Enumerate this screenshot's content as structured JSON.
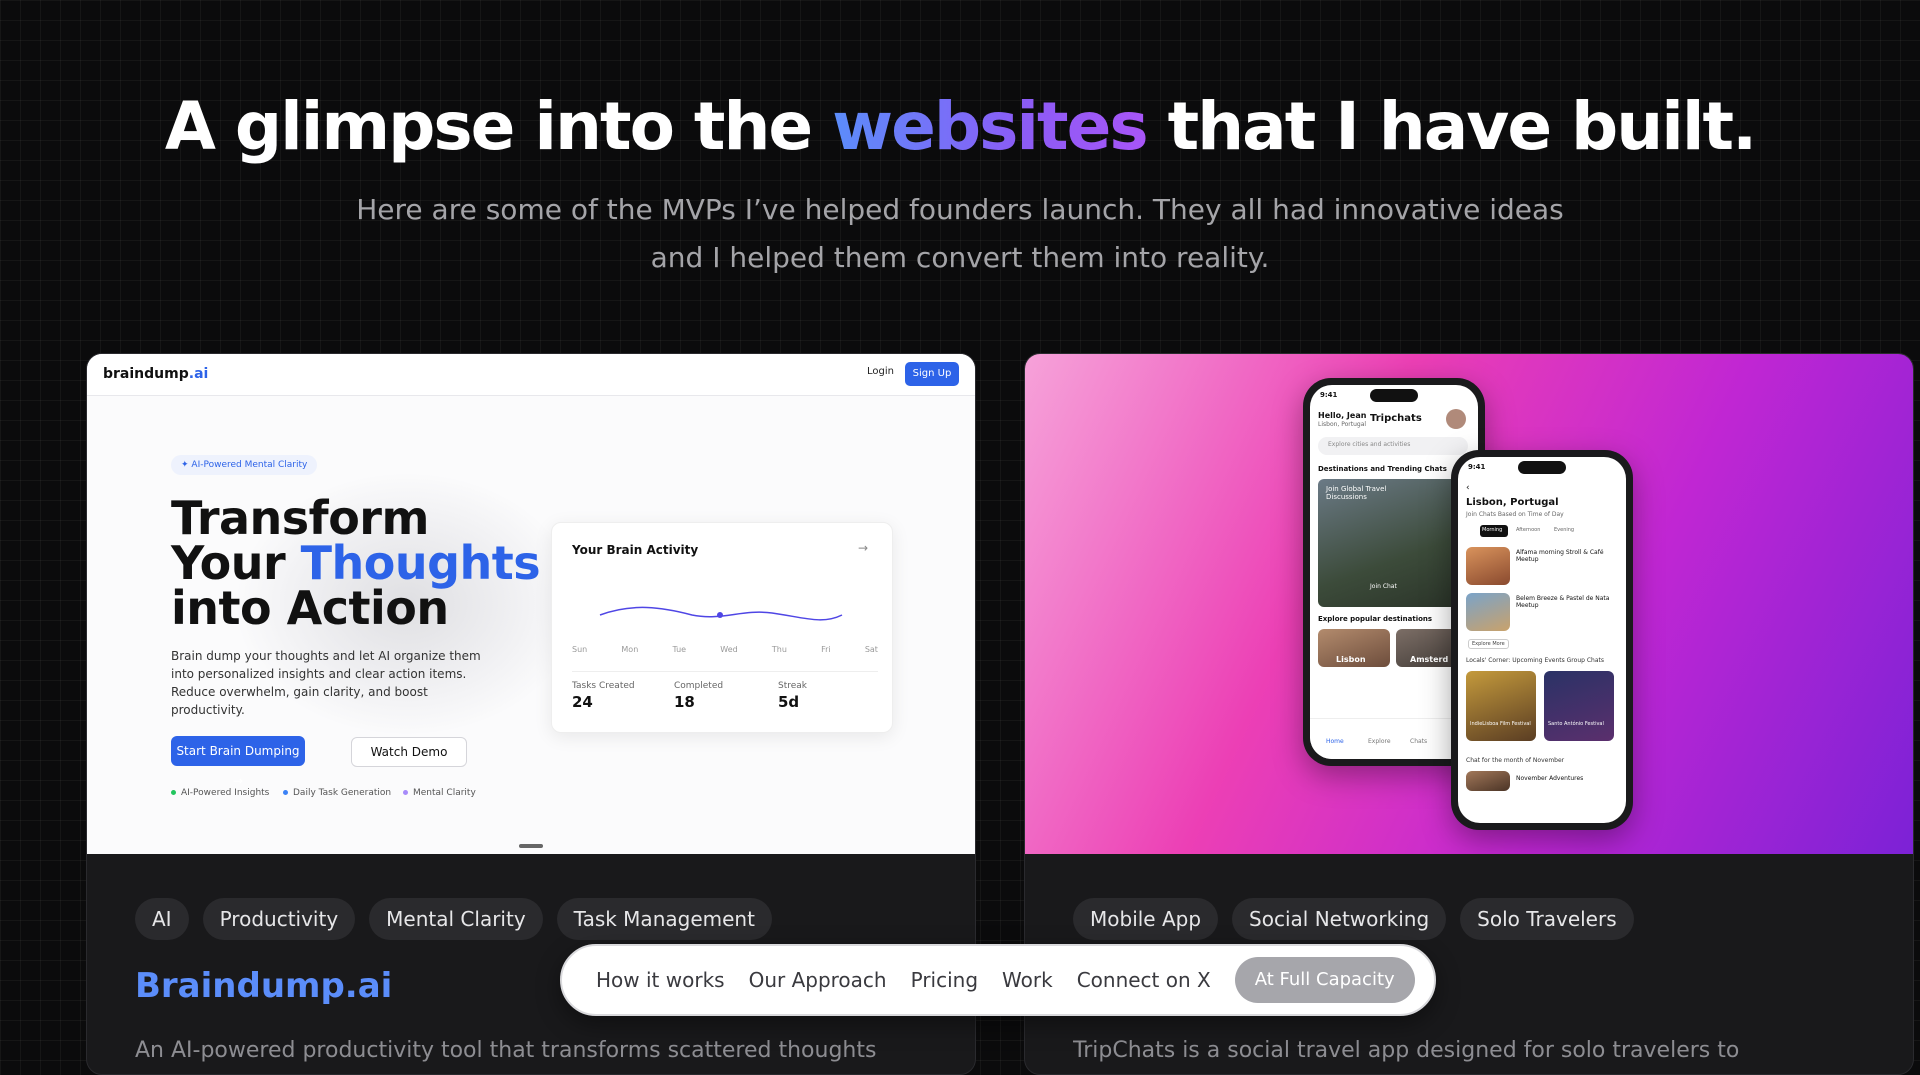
{
  "headline": {
    "before": "A glimpse into the ",
    "highlight": "websites",
    "after": " that I have built."
  },
  "subtitle": "Here are some of the MVPs I’ve helped founders launch. They all had innovative ideas and I helped them convert them into reality.",
  "projects": [
    {
      "tags": [
        "AI",
        "Productivity",
        "Mental Clarity",
        "Task Management"
      ],
      "title": "Braindump.ai",
      "description": "An AI-powered productivity tool that transforms scattered thoughts",
      "preview": {
        "logo": "braindump",
        "logo_accent": ".ai",
        "login": "Login",
        "signup": "Sign Up",
        "badge": "AI-Powered Mental Clarity",
        "h1_line1": "Transform",
        "h1_line2a": "Your ",
        "h1_line2b": "Thoughts",
        "h1_line3": "into Action",
        "desc": "Brain dump your thoughts and let AI organize them into personalized insights and clear action items. Reduce overwhelm, gain clarity, and boost productivity.",
        "btn_primary": "Start Brain Dumping →",
        "btn_secondary": "Watch Demo",
        "features": [
          "AI-Powered Insights",
          "Daily Task Generation",
          "Mental Clarity"
        ],
        "panel_title": "Your Brain Activity",
        "days": [
          "Sun",
          "Mon",
          "Tue",
          "Wed",
          "Thu",
          "Fri",
          "Sat"
        ],
        "stats": [
          {
            "label": "Tasks Created",
            "value": "24"
          },
          {
            "label": "Completed",
            "value": "18"
          },
          {
            "label": "Streak",
            "value": "5d"
          }
        ]
      }
    },
    {
      "tags": [
        "Mobile App",
        "Social Networking",
        "Solo Travelers"
      ],
      "title": "",
      "description": "TripChats is a social travel app designed for solo travelers to",
      "preview": {
        "phone1": {
          "time": "9:41",
          "greeting": "Hello, Jean",
          "location": "Lisbon, Portugal",
          "app": "Tripchats",
          "search": "Explore cities and activities",
          "section1": "Destinations and Trending Chats",
          "card_title": "Join Global Travel Discussions",
          "join": "Join Chat",
          "section2": "Explore popular destinations",
          "dest1": "Lisbon",
          "dest2": "Amsterd",
          "tabs": [
            "Home",
            "Explore",
            "Chats"
          ]
        },
        "phone2": {
          "time": "9:41",
          "city": "Lisbon, Portugal",
          "sub": "Join Chats Based on Time of Day",
          "times": [
            "Morning",
            "Afternoon",
            "Evening"
          ],
          "item1": "Alfama morning Stroll & Café Meetup",
          "item2": "Belem Breeze & Pastel de Nata Meetup",
          "explore": "Explore More",
          "section": "Locals' Corner: Upcoming Events Group Chats",
          "event1": "IndieLisboa Film Festival",
          "event2": "Santo António Festival",
          "footer": "Chat for the month of November",
          "footer2": "November Adventures"
        }
      }
    }
  ],
  "nav": {
    "links": [
      "How it works",
      "Our Approach",
      "Pricing",
      "Work",
      "Connect on X"
    ],
    "cta": "At Full Capacity"
  }
}
